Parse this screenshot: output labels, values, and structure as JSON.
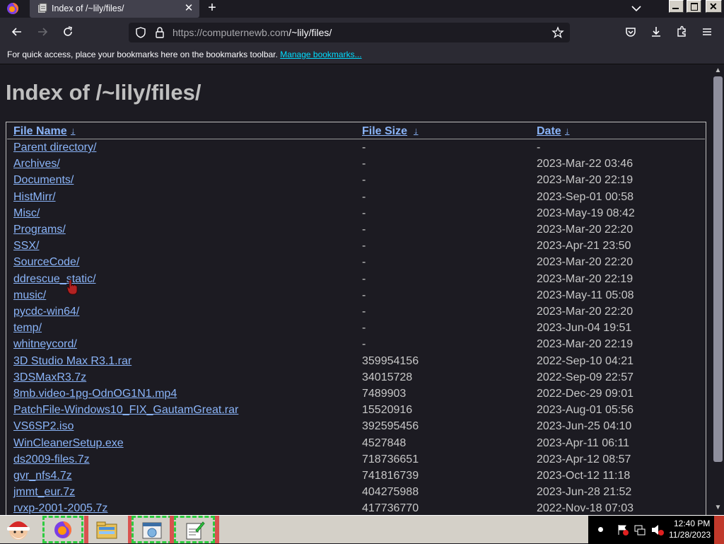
{
  "browser": {
    "tab_title": "Index of /~lily/files/",
    "url_host": "https://computernewb.com",
    "url_path": "/~lily/files/",
    "bookmarks_text": "For quick access, place your bookmarks here on the bookmarks toolbar.",
    "bookmarks_link": "Manage bookmarks..."
  },
  "page": {
    "title": "Index of /~lily/files/",
    "columns": {
      "name": "File Name",
      "size": "File Size",
      "date": "Date",
      "sort_arrow": "↓"
    },
    "rows": [
      {
        "name": "Parent directory/",
        "size": "-",
        "date": "-"
      },
      {
        "name": "Archives/",
        "size": "-",
        "date": "2023-Mar-22 03:46"
      },
      {
        "name": "Documents/",
        "size": "-",
        "date": "2023-Mar-20 22:19"
      },
      {
        "name": "HistMirr/",
        "size": "-",
        "date": "2023-Sep-01 00:58"
      },
      {
        "name": "Misc/",
        "size": "-",
        "date": "2023-May-19 08:42"
      },
      {
        "name": "Programs/",
        "size": "-",
        "date": "2023-Mar-20 22:20"
      },
      {
        "name": "SSX/",
        "size": "-",
        "date": "2023-Apr-21 23:50"
      },
      {
        "name": "SourceCode/",
        "size": "-",
        "date": "2023-Mar-20 22:20"
      },
      {
        "name": "ddrescue_static/",
        "size": "-",
        "date": "2023-Mar-20 22:19"
      },
      {
        "name": "music/",
        "size": "-",
        "date": "2023-May-11 05:08"
      },
      {
        "name": "pycdc-win64/",
        "size": "-",
        "date": "2023-Mar-20 22:20"
      },
      {
        "name": "temp/",
        "size": "-",
        "date": "2023-Jun-04 19:51"
      },
      {
        "name": "whitneycord/",
        "size": "-",
        "date": "2023-Mar-20 22:19"
      },
      {
        "name": "3D Studio Max R3.1.rar",
        "size": "359954156",
        "date": "2022-Sep-10 04:21"
      },
      {
        "name": "3DSMaxR3.7z",
        "size": "34015728",
        "date": "2022-Sep-09 22:57"
      },
      {
        "name": "8mb.video-1pg-OdnOG1N1.mp4",
        "size": "7489903",
        "date": "2022-Dec-29 09:01"
      },
      {
        "name": "PatchFile-Windows10_FIX_GautamGreat.rar",
        "size": "15520916",
        "date": "2023-Aug-01 05:56"
      },
      {
        "name": "VS6SP2.iso",
        "size": "392595456",
        "date": "2023-Jun-25 04:10"
      },
      {
        "name": "WinCleanerSetup.exe",
        "size": "4527848",
        "date": "2023-Apr-11 06:11"
      },
      {
        "name": "ds2009-files.7z",
        "size": "718736651",
        "date": "2023-Apr-12 08:57"
      },
      {
        "name": "gvr_nfs4.7z",
        "size": "741816739",
        "date": "2023-Oct-12 11:18"
      },
      {
        "name": "jmmt_eur.7z",
        "size": "404275988",
        "date": "2023-Jun-28 21:52"
      },
      {
        "name": "rvxp-2001-2005.7z",
        "size": "417736770",
        "date": "2022-Nov-18 07:03"
      }
    ]
  },
  "taskbar": {
    "time": "12:40 PM",
    "date": "11/28/2023"
  }
}
